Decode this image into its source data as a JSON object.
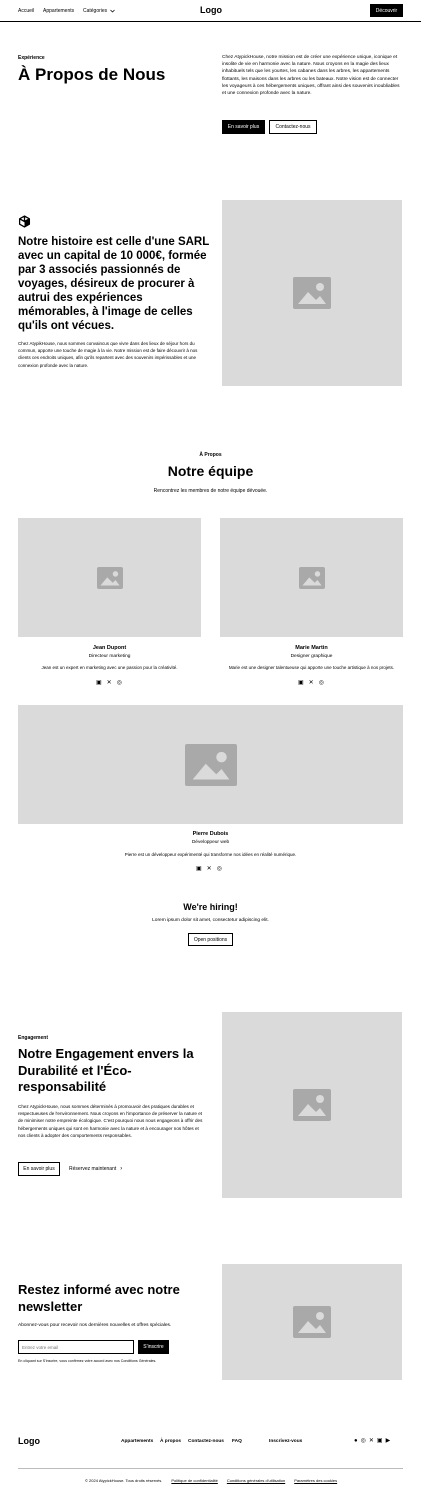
{
  "nav": {
    "links": [
      "Accueil",
      "Appartements",
      "Catégories"
    ],
    "logo": "Logo",
    "cta": "Découvrir"
  },
  "hero": {
    "tagline": "Expérience",
    "title": "À Propos de Nous",
    "description": "Chez AtypickHouse, notre mission est de créer une expérience unique, iconique et insolite de vie en harmonie avec la nature. Nous croyons en la magie des lieux inhabituels tels que les yourtes, les cabanes dans les arbres, les appartements flottants, les maisons dans les arbres ou les bateaux. Notre vision est de connecter les voyageurs à ces hébergements uniques, offrant ainsi des souvenirs inoubliables et une connexion profonde avec la nature.",
    "btn_primary": "En savoir plus",
    "btn_secondary": "Contactez-nous"
  },
  "story": {
    "title": "Notre histoire est celle d'une SARL avec un capital de 10 000€, formée par 3 associés passionnés de voyages, désireux de procurer à autrui des expériences mémorables, à l'image de celles qu'ils ont vécues.",
    "text": "Chez AtypikHouse, nous sommes convaincus que vivre dans des lieux de séjour hors du commun, apporte une touche de magie à la vie. Notre mission est de faire découvrir à nos clients ces endroits uniques, afin qu'ils repartent avec des souvenirs impérissables et une connexion profonde avec la nature."
  },
  "team": {
    "tagline": "À Propos",
    "title": "Notre équipe",
    "subtitle": "Rencontrez les membres de notre équipe dévouée.",
    "members": [
      {
        "name": "Jean Dupont",
        "role": "Directeur marketing",
        "bio": "Jean est un expert en marketing avec une passion pour la créativité."
      },
      {
        "name": "Marie Martin",
        "role": "Designer graphique",
        "bio": "Marie est une designer talentueuse qui apporte une touche artistique à nos projets."
      },
      {
        "name": "Pierre Dubois",
        "role": "Développeur web",
        "bio": "Pierre est un développeur expérimenté qui transforme nos idées en réalité numérique."
      }
    ],
    "hiring_title": "We're hiring!",
    "hiring_text": "Lorem ipsum dolor sit amet, consectetur adipiscing elit.",
    "hiring_btn": "Open positions"
  },
  "engagement": {
    "tagline": "Engagement",
    "title": "Notre Engagement envers la Durabilité et l'Éco-responsabilité",
    "text": "Chez AtypickHouse, nous sommes déterminés à promouvoir des pratiques durables et respectueuses de l'environnement. Nous croyons en l'importance de préserver la nature et de minimiser notre empreinte écologique. C'est pourquoi nous nous engageons à offrir des hébergements uniques qui sont en harmonie avec la nature et à encourager nos hôtes et nos clients à adopter des comportements responsables.",
    "btn_primary": "En savoir plus",
    "btn_link": "Réservez maintenant"
  },
  "newsletter": {
    "title": "Restez informé avec notre newsletter",
    "text": "Abonnez-vous pour recevoir nos dernières nouvelles et offres spéciales.",
    "placeholder": "Entrez votre email",
    "btn": "S'inscrire",
    "disclaimer": "En cliquant sur S'inscrire, vous confirmez votre accord avec nos Conditions Générales."
  },
  "footer": {
    "logo": "Logo",
    "links": [
      "Appartements",
      "À propos",
      "Contactez-nous",
      "FAQ"
    ],
    "register": "Inscrivez-vous",
    "copyright": "© 2024 AtypickHouse. Tous droits réservés.",
    "legal": [
      "Politique de confidentialité",
      "Conditions générales d'utilisation",
      "Paramètres des cookies"
    ]
  }
}
